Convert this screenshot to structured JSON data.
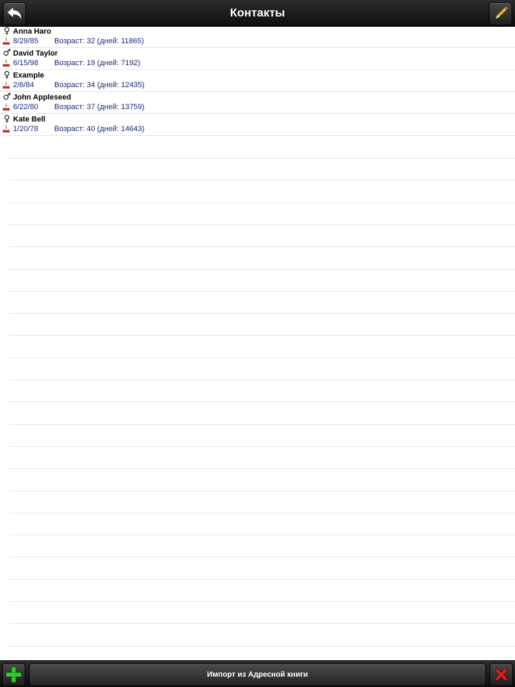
{
  "navbar": {
    "title": "Контакты",
    "back_icon": "back-arrow-icon",
    "edit_icon": "pencil-icon"
  },
  "contacts": [
    {
      "name": "Anna Haro",
      "gender": "female",
      "gender_symbol": "♀",
      "date": "8/29/85",
      "age": "Возраст: 32 (дней: 11865)"
    },
    {
      "name": "David Taylor",
      "gender": "male",
      "gender_symbol": "♂",
      "date": "6/15/98",
      "age": "Возраст: 19 (дней: 7192)"
    },
    {
      "name": "Example",
      "gender": "female",
      "gender_symbol": "♀",
      "date": "2/6/84",
      "age": "Возраст: 34 (дней: 12435)"
    },
    {
      "name": "John Appleseed",
      "gender": "male",
      "gender_symbol": "♂",
      "date": "6/22/80",
      "age": "Возраст: 37 (дней: 13759)"
    },
    {
      "name": "Kate Bell",
      "gender": "female",
      "gender_symbol": "♀",
      "date": "1/20/78",
      "age": "Возраст: 40 (дней: 14643)"
    }
  ],
  "toolbar": {
    "import_label": "Импорт из Адресной книги",
    "add_icon": "plus-icon",
    "delete_icon": "close-icon"
  },
  "colors": {
    "bar": "#1a1a1a",
    "date_text": "#1a2a7a",
    "add_green": "#2fd12f",
    "delete_red": "#e02020"
  }
}
